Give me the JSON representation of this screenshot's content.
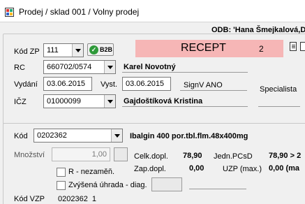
{
  "window": {
    "title": "Prodej / sklad 001 / Volny prodej"
  },
  "header": {
    "odb": "ODB: 'Hana Šmejkalová,Dr"
  },
  "prescription": {
    "kod_zp_label": "Kód ZP",
    "kod_zp_value": "111",
    "b2b_label": "B2B",
    "recept_title": "RECEPT",
    "recept_number": "2",
    "rc_label": "RC",
    "rc_value": "660702/0574",
    "patient_name": "Karel Novotný",
    "vydani_label": "Vydání",
    "vydani_value": "03.06.2015",
    "vyst_label": "Vyst.",
    "vyst_value": "03.06.2015",
    "signv": "SignV ANO",
    "specialista_label": "Specialista",
    "icz_label": "IČZ",
    "icz_value": "01000099",
    "doctor_name": "Gajdoštíková Kristina"
  },
  "item": {
    "kod_label": "Kód",
    "kod_value": "0202362",
    "product_name": "Ibalgin 400 por.tbl.flm.48x400mg",
    "mnozstvi_label": "Množství",
    "mnozstvi_value": "1,00",
    "celk_dopl_label": "Celk.dopl.",
    "celk_dopl_value": "78,90",
    "jedn_pcsd_label": "Jedn.PCsD",
    "jedn_pcsd_value": "78,90 > 2",
    "zap_dopl_label": "Zap.dopl.",
    "zap_dopl_value": "0,00",
    "uzp_label": "UZP (max.)",
    "uzp_value": "0,00 (ma",
    "r_nezamen_label": "R - nezaměň.",
    "zvysena_label": "Zvýšená úhrada",
    "diag_label": "- diag.",
    "kod_vzp_label": "Kód VZP",
    "kod_vzp_value": "0202362  1"
  }
}
